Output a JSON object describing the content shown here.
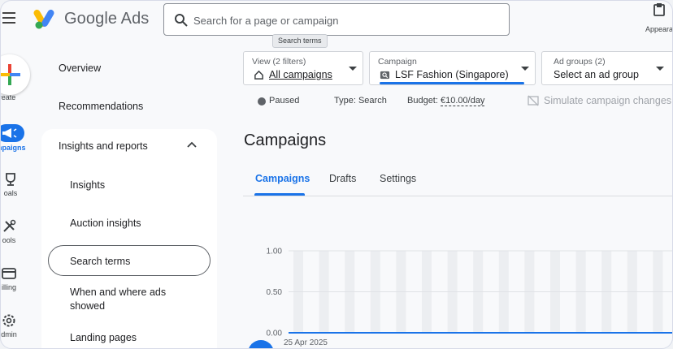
{
  "header": {
    "brand": "Google Ads",
    "search_placeholder": "Search for a page or campaign",
    "tooltip": "Search terms",
    "appearance": "Appeara"
  },
  "rail": {
    "create": "reate",
    "campaigns": "mpaigns",
    "goals": "oals",
    "tools": "ools",
    "billing": "illing",
    "admin": "dmin"
  },
  "nav": {
    "overview": "Overview",
    "recommendations": "Recommendations",
    "insights_reports": "Insights and reports",
    "items": [
      "Insights",
      "Auction insights",
      "Search terms",
      "When and where ads showed",
      "Landing pages"
    ],
    "item_lines_when_1": "When and where ads",
    "item_lines_when_2": "showed"
  },
  "filters": {
    "view_label": "View (2 filters)",
    "view_value": "All campaigns",
    "campaign_label": "Campaign",
    "campaign_value": "LSF Fashion (Singapore)",
    "adgroups_label": "Ad groups (2)",
    "adgroups_value": "Select an ad group"
  },
  "status": {
    "paused": "Paused",
    "type": "Type: Search",
    "budget_label": "Budget:",
    "budget_value": "€10.00/day",
    "simulate": "Simulate campaign changes"
  },
  "main": {
    "title": "Campaigns",
    "tabs": [
      "Campaigns",
      "Drafts",
      "Settings"
    ]
  },
  "chart_data": {
    "type": "bar",
    "categories": [
      "25 Apr 2025"
    ],
    "y_ticks": [
      "1.00",
      "0.50",
      "0.00"
    ],
    "ylim": [
      0,
      1
    ],
    "values": [
      0
    ],
    "grid": true,
    "accent": "#1a73e8"
  },
  "colors": {
    "accent": "#1a73e8",
    "google_blue": "#4285f4",
    "google_red": "#ea4335",
    "google_yellow": "#fbbc04",
    "google_green": "#34a853"
  }
}
